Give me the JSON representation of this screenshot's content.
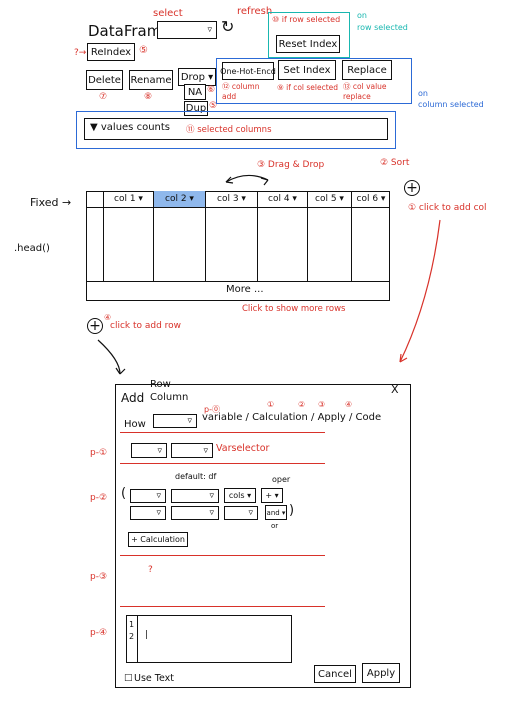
{
  "top": {
    "title": "DataFrame",
    "select_label": "select",
    "refresh_label": "refresh",
    "reindex_prefix": "?→",
    "reindex_label": "ReIndex",
    "reindex_num": "⑤",
    "delete_label": "Delete",
    "delete_num": "⑦",
    "rename_label": "Rename",
    "rename_num": "⑧",
    "drop_label": "Drop ▾",
    "na_label": "NA",
    "na_num": "⑥",
    "dup_label": "Dup",
    "dup_num": "⑤",
    "reset_note": "⑩ if row selected",
    "reset_label": "Reset Index",
    "on_row_selected": "on\nrow selected",
    "onehot_label": "One-Hot-Encd",
    "setindex_label": "Set Index",
    "replace_label": "Replace",
    "onehot_note": "⑫ column\nadd",
    "setindex_note": "⑨ if col selected",
    "replace_note": "⑬ col value\nreplace",
    "on_column_selected": "on\ncolumn selected",
    "value_counts_label": "▼ values counts",
    "value_counts_note": "⑪ selected columns"
  },
  "grid": {
    "fixed_label": "Fixed →",
    "head_label": ".head()",
    "drag_drop_label": "③ Drag & Drop",
    "sort_label": "② Sort",
    "add_col_label": "① click to add col",
    "columns": [
      "col 1 ▾",
      "col 2 ▾",
      "col 3 ▾",
      "col 4 ▾",
      "col 5 ▾",
      "col 6 ▾"
    ],
    "more_label": "More ...",
    "more_note": "Click to show more rows",
    "add_row_label": "click to add row",
    "add_row_num": "④",
    "plus": "+"
  },
  "dialog": {
    "add_label": "Add",
    "row_label": "Row",
    "column_label": "Column",
    "close": "X",
    "how_label": "How",
    "p0_label": "p-⓪",
    "how_options": "variable / Calculation / Apply / Code",
    "p1_label": "p-①",
    "p2_label": "p-②",
    "p3_label": "p-③",
    "p4_label": "p-④",
    "varselector_label": "Varselector",
    "default_label": "default: df",
    "oper_label": "oper",
    "cols_label": "cols ▾",
    "plus_op": "+ ▾",
    "andor_op": "and ▾",
    "or_label": "or",
    "open_paren": "(",
    "close_paren": ")",
    "add_calc_label": "+ Calculation",
    "apply_placeholder": "?",
    "code_lines": [
      "1",
      "2"
    ],
    "code_cursor": "|",
    "use_text_label": "Use Text",
    "cancel_label": "Cancel",
    "apply_label": "Apply",
    "num_1": "①",
    "num_2": "②",
    "num_3": "③",
    "num_4": "④"
  }
}
